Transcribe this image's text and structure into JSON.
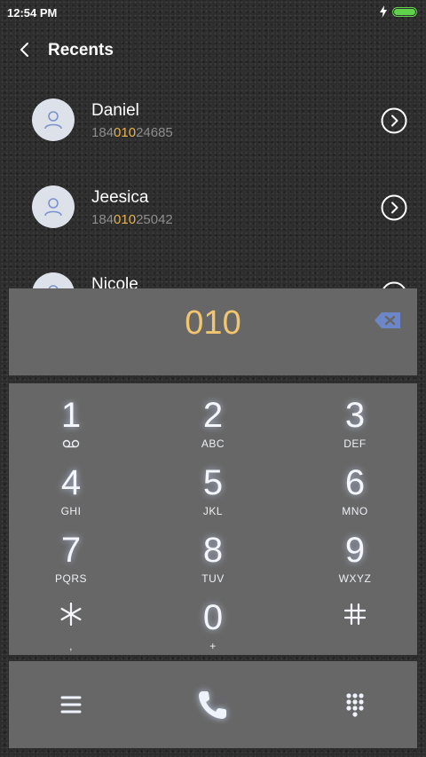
{
  "status_bar": {
    "time": "12:54 PM",
    "charging_icon": "bolt-icon",
    "battery_icon": "battery-icon",
    "battery_color": "#5fd14a",
    "battery_level": 1.0
  },
  "header": {
    "back_icon": "chevron-left-icon",
    "title": "Recents"
  },
  "recents": [
    {
      "name": "Daniel",
      "number_pre": "184",
      "number_match": "010",
      "number_post": "24685"
    },
    {
      "name": "Jeesica",
      "number_pre": "184",
      "number_match": "010",
      "number_post": "25042"
    },
    {
      "name": "Nicole",
      "number_pre": "",
      "number_match": "",
      "number_post": ""
    }
  ],
  "dial_display": {
    "number": "010",
    "number_color": "#f2c56f",
    "backspace_icon": "backspace-icon",
    "backspace_color": "#6c86c7"
  },
  "keypad": {
    "keys": [
      {
        "digit": "1",
        "letters": "",
        "sub_icon": "voicemail-icon"
      },
      {
        "digit": "2",
        "letters": "ABC"
      },
      {
        "digit": "3",
        "letters": "DEF"
      },
      {
        "digit": "4",
        "letters": "GHI"
      },
      {
        "digit": "5",
        "letters": "JKL"
      },
      {
        "digit": "6",
        "letters": "MNO"
      },
      {
        "digit": "7",
        "letters": "PQRS"
      },
      {
        "digit": "8",
        "letters": "TUV"
      },
      {
        "digit": "9",
        "letters": "WXYZ"
      },
      {
        "digit": "*",
        "letters": ",",
        "icon": "asterisk-icon"
      },
      {
        "digit": "0",
        "letters": "+"
      },
      {
        "digit": "#",
        "letters": "",
        "icon": "hash-icon"
      }
    ]
  },
  "bottom_bar": {
    "menu_icon": "menu-icon",
    "call_icon": "phone-icon",
    "keypad_icon": "dialpad-icon",
    "highlight_color": "#cfe0ff"
  },
  "highlight_match_color": "#e8b44f"
}
